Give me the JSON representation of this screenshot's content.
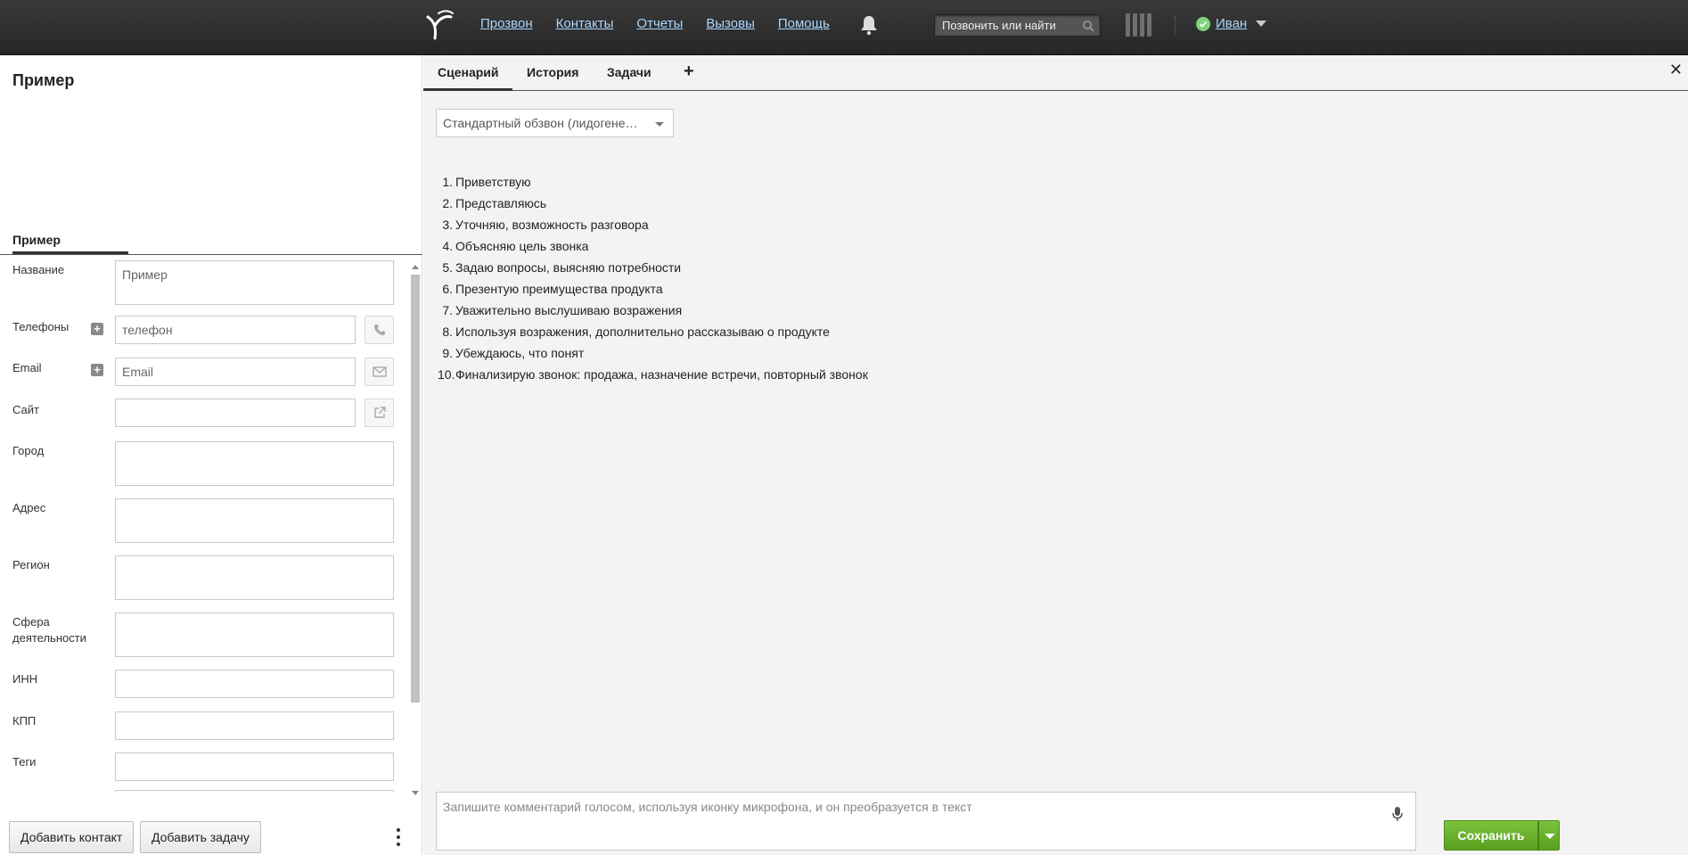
{
  "nav": {
    "items": [
      "Прозвон",
      "Контакты",
      "Отчеты",
      "Вызовы",
      "Помощь"
    ],
    "search_placeholder": "Позвонить или найти",
    "user_name": "Иван",
    "icons": [
      "logo-icon",
      "bell-icon",
      "search-icon",
      "columns-icon",
      "status-online-icon",
      "chevron-down-icon"
    ]
  },
  "contact": {
    "title": "Пример",
    "tab_label": "Пример",
    "fields": {
      "name_label": "Название",
      "name_value": "Пример",
      "phones_label": "Телефоны",
      "phone_placeholder": "телефон",
      "email_label": "Email",
      "email_placeholder": "Email",
      "site_label": "Сайт",
      "city_label": "Город",
      "address_label": "Адрес",
      "region_label": "Регион",
      "sphere_label": "Сфера деятельности",
      "inn_label": "ИНН",
      "kpp_label": "КПП",
      "tags_label": "Теги"
    },
    "buttons": {
      "add_contact": "Добавить контакт",
      "add_task": "Добавить задачу"
    }
  },
  "right": {
    "tabs": [
      "Сценарий",
      "История",
      "Задачи"
    ],
    "add_tab_symbol": "+",
    "close_symbol": "✕",
    "script_select": "Стандартный обзвон (лидогене…",
    "script_steps": [
      "Приветствую",
      "Представляюсь",
      "Уточняю, возможность разговора",
      "Объясняю цель звонка",
      "Задаю вопросы, выясняю потребности",
      "Презентую преимущества продукта",
      "Уважительно выслушиваю возражения",
      "Используя возражения, дополнительно рассказываю о продукте",
      "Убеждаюсь, что понят",
      "Финализирую звонок: продажа, назначение встречи, повторный звонок"
    ],
    "comment_placeholder": "Запишите комментарий голосом, используя иконку микрофона, и он преобразуется в текст",
    "save_label": "Сохранить"
  },
  "colors": {
    "topbar": "#2e2e2e",
    "link": "#a9d6ff",
    "save_green": "#6db22f",
    "status_green": "#7ed27b"
  }
}
